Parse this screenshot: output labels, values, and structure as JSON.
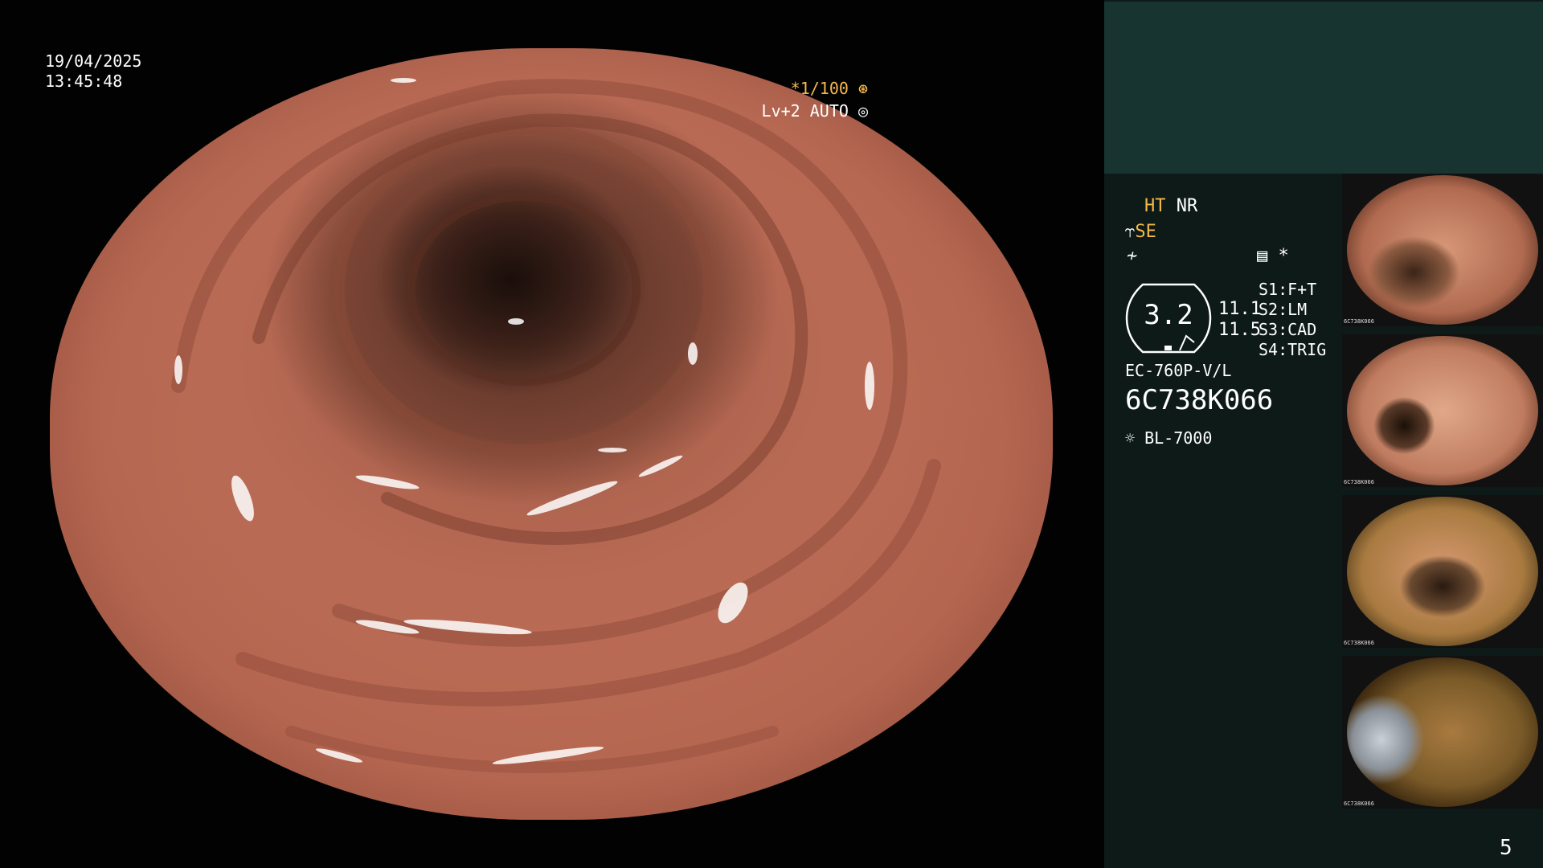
{
  "overlay": {
    "date": "19/04/2025",
    "time": "13:45:48",
    "shutter": "*1/100",
    "level": "Lv+2 AUTO"
  },
  "panel": {
    "ht": "HT",
    "nr": "NR",
    "se": "SE",
    "scope_value": "3.2",
    "value_1": "11.1",
    "value_2": "11.5",
    "switches": [
      "S1:F+T",
      "S2:LM",
      "S3:CAD",
      "S4:TRIG"
    ],
    "scope_model": "EC-760P-V/L",
    "serial": "6C738K066",
    "light_source": "BL-7000",
    "page_number": "5"
  },
  "thumbnails": [
    {
      "caption": "6C738K066"
    },
    {
      "caption": "6C738K066"
    },
    {
      "caption": "6C738K066"
    },
    {
      "caption": "6C738K066"
    }
  ],
  "colors": {
    "accent": "#f5b94a",
    "panel_bg": "#0d1a18",
    "banner_bg": "#183431",
    "mucosa": "#c4745c"
  }
}
